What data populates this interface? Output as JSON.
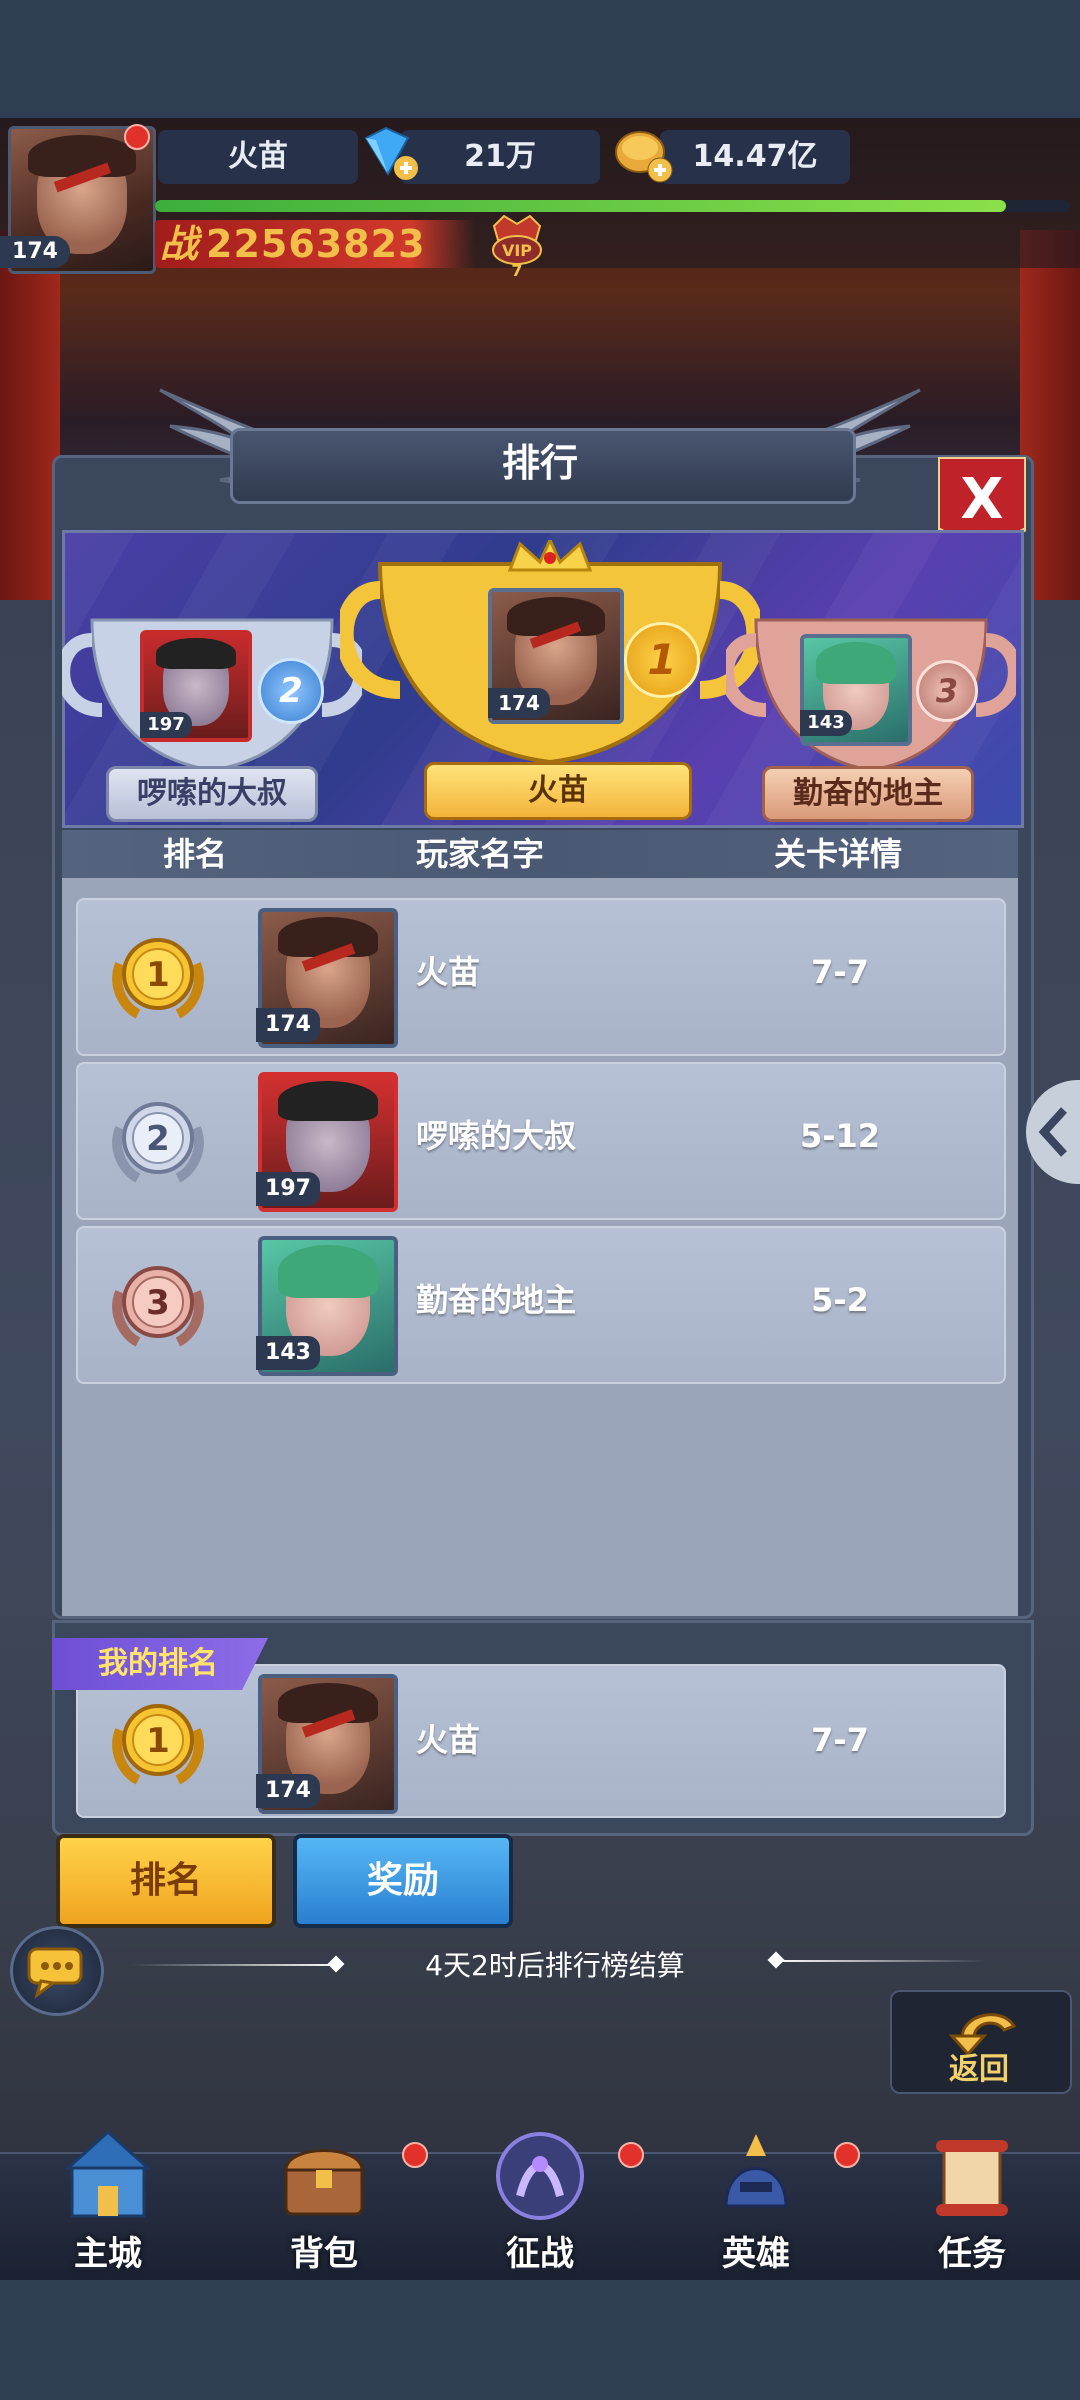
{
  "hud": {
    "level": "174",
    "player_name": "火苗",
    "diamonds": "21万",
    "gold": "14.47亿",
    "power_prefix": "战",
    "power": "22563823",
    "vip_label": "VIP",
    "vip_level": "7",
    "xp_fraction": 0.93
  },
  "panel": {
    "title": "排行",
    "close_label": "X"
  },
  "podium": [
    {
      "place": "2",
      "name": "啰嗦的大叔",
      "level": "197"
    },
    {
      "place": "1",
      "name": "火苗",
      "level": "174"
    },
    {
      "place": "3",
      "name": "勤奋的地主",
      "level": "143"
    }
  ],
  "table": {
    "columns": [
      "排名",
      "玩家名字",
      "关卡详情"
    ],
    "rows": [
      {
        "rank": "1",
        "name": "火苗",
        "level": "174",
        "stage": "7-7"
      },
      {
        "rank": "2",
        "name": "啰嗦的大叔",
        "level": "197",
        "stage": "5-12"
      },
      {
        "rank": "3",
        "name": "勤奋的地主",
        "level": "143",
        "stage": "5-2"
      }
    ]
  },
  "my_rank": {
    "label": "我的排名",
    "rank": "1",
    "name": "火苗",
    "level": "174",
    "stage": "7-7"
  },
  "tabs": {
    "rank": "排名",
    "reward": "奖励"
  },
  "countdown": "4天2时后排行榜结算",
  "back_label": "返回",
  "nav": [
    "主城",
    "背包",
    "征战",
    "英雄",
    "任务"
  ],
  "colors": {
    "gold": "#f2c04a",
    "silver": "#c8d2e6",
    "bronze": "#e0a39a",
    "panel": "#3b475d"
  }
}
